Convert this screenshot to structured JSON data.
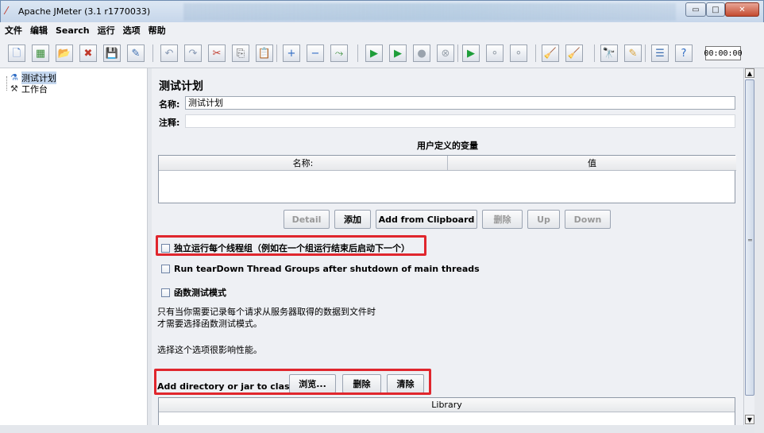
{
  "window": {
    "title": "Apache JMeter (3.1 r1770033)",
    "minimize_glyph": "▭",
    "maximize_glyph": "□",
    "close_glyph": "✕"
  },
  "menubar": {
    "items": [
      "文件",
      "编辑",
      "Search",
      "运行",
      "选项",
      "帮助"
    ]
  },
  "toolbar": {
    "buttons": [
      {
        "name": "new-icon",
        "glyph": "🗋",
        "color": "#4a78c2"
      },
      {
        "name": "templates-icon",
        "glyph": "▦",
        "color": "#3b8f3b"
      },
      {
        "name": "open-icon",
        "glyph": "📂",
        "color": "#d8a23a"
      },
      {
        "name": "close-file-icon",
        "glyph": "✖",
        "color": "#c0392b"
      },
      {
        "name": "save-icon",
        "glyph": "💾",
        "color": "#333"
      },
      {
        "name": "save-as-image-icon",
        "glyph": "✎",
        "color": "#3b6db0"
      },
      {
        "name": "undo-icon",
        "glyph": "↶",
        "color": "#8a9bb5"
      },
      {
        "name": "redo-icon",
        "glyph": "↷",
        "color": "#8a9bb5"
      },
      {
        "name": "cut-icon",
        "glyph": "✂",
        "color": "#c0392b"
      },
      {
        "name": "copy-icon",
        "glyph": "⎘",
        "color": "#555"
      },
      {
        "name": "paste-icon",
        "glyph": "📋",
        "color": "#8a6a3a"
      },
      {
        "name": "expand-icon",
        "glyph": "+",
        "color": "#2d6bc4"
      },
      {
        "name": "collapse-icon",
        "glyph": "−",
        "color": "#2d6bc4"
      },
      {
        "name": "toggle-icon",
        "glyph": "⤳",
        "color": "#3b8f3b"
      },
      {
        "name": "start-icon",
        "glyph": "▶",
        "color": "#1e9e3a"
      },
      {
        "name": "start-no-pauses-icon",
        "glyph": "▶",
        "color": "#1e9e3a"
      },
      {
        "name": "stop-icon",
        "glyph": "●",
        "color": "#9aa3ad"
      },
      {
        "name": "shutdown-icon",
        "glyph": "⊗",
        "color": "#9aa3ad"
      },
      {
        "name": "remote-start-icon",
        "glyph": "▶",
        "color": "#1e9e3a"
      },
      {
        "name": "remote-stop-icon",
        "glyph": "⚬",
        "color": "#9aa3ad"
      },
      {
        "name": "remote-shutdown-icon",
        "glyph": "⚬",
        "color": "#9aa3ad"
      },
      {
        "name": "clear-icon",
        "glyph": "🧹",
        "color": "#6a8f3a"
      },
      {
        "name": "clear-all-icon",
        "glyph": "🧹",
        "color": "#8a6a3a"
      },
      {
        "name": "search-icon",
        "glyph": "🔭",
        "color": "#333"
      },
      {
        "name": "reset-search-icon",
        "glyph": "✎",
        "color": "#d8a23a"
      },
      {
        "name": "function-helper-icon",
        "glyph": "☰",
        "color": "#3b6db0"
      },
      {
        "name": "help-icon",
        "glyph": "?",
        "color": "#2d6bc4"
      }
    ],
    "timer": "00:00:00"
  },
  "tree": {
    "nodes": [
      {
        "label": "测试计划",
        "icon": "test-plan-icon",
        "glyph": "⚗"
      },
      {
        "label": "工作台",
        "icon": "workbench-icon",
        "glyph": "⚒"
      }
    ]
  },
  "testplan": {
    "title": "测试计划",
    "name_label": "名称:",
    "name_value": "测试计划",
    "comment_label": "注释:",
    "comment_value": "",
    "vars_title": "用户定义的变量",
    "vars_columns": [
      "名称:",
      "值"
    ],
    "buttons": {
      "detail": "Detail",
      "add": "添加",
      "add_from_clipboard": "Add from Clipboard",
      "delete": "删除",
      "up": "Up",
      "down": "Down"
    },
    "checkboxes": {
      "serialize": "独立运行每个线程组（例如在一个组运行结束后启动下一个）",
      "teardown": "Run tearDown Thread Groups after shutdown of main threads",
      "functional": "函数测试模式"
    },
    "notes": {
      "line1": "只有当你需要记录每个请求从服务器取得的数据到文件时",
      "line2": "才需要选择函数测试模式。",
      "line3": "选择这个选项很影响性能。"
    },
    "classpath": {
      "label": "Add directory or jar to classpath",
      "browse": "浏览...",
      "delete": "删除",
      "clear": "清除",
      "library_header": "Library"
    }
  },
  "colors": {
    "highlight": "#e0262d",
    "selection": "#c3d6ee",
    "panel_bg": "#eef0f4"
  }
}
